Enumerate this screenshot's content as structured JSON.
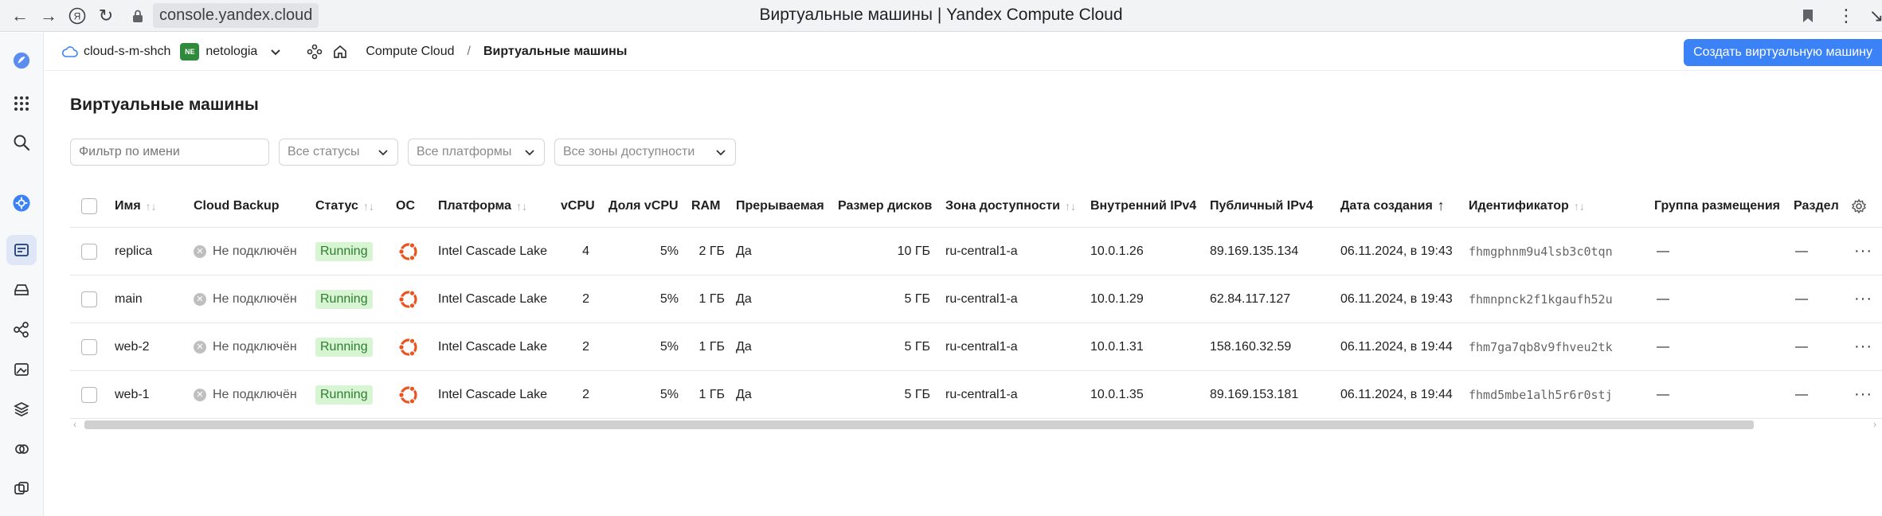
{
  "browser": {
    "url": "console.yandex.cloud",
    "tab_title": "Виртуальные машины | Yandex Compute Cloud"
  },
  "header": {
    "cloud": "cloud-s-m-shch",
    "folder_badge": "NE",
    "folder": "netologia",
    "breadcrumb_service": "Compute Cloud",
    "breadcrumb_sep": "/",
    "breadcrumb_current": "Виртуальные машины",
    "create_button": "Создать виртуальную машину"
  },
  "page": {
    "title": "Виртуальные машины"
  },
  "filters": {
    "name_placeholder": "Фильтр по имени",
    "status": "Все статусы",
    "platform": "Все платформы",
    "zone": "Все зоны доступности"
  },
  "table": {
    "columns": {
      "name": "Имя",
      "backup": "Cloud Backup",
      "status": "Статус",
      "os": "ОС",
      "platform": "Платформа",
      "vcpu": "vCPU",
      "core_fraction": "Доля vCPU",
      "ram": "RAM",
      "preemptible": "Прерываемая",
      "disk": "Размер дисков",
      "zone": "Зона доступности",
      "internal_ip": "Внутренний IPv4",
      "public_ip": "Публичный IPv4",
      "created": "Дата создания",
      "id": "Идентификатор",
      "placement": "Группа размещения",
      "section": "Раздел"
    },
    "rows": [
      {
        "name": "replica",
        "backup": "Не подключён",
        "status": "Running",
        "os": "ubuntu-icon",
        "platform": "Intel Cascade Lake",
        "vcpu": "4",
        "core_fraction": "5%",
        "ram": "2 ГБ",
        "preemptible": "Да",
        "disk": "10 ГБ",
        "zone": "ru-central1-a",
        "internal_ip": "10.0.1.26",
        "public_ip": "89.169.135.134",
        "created": "06.11.2024, в 19:43",
        "id": "fhmgphnm9u4lsb3c0tqn",
        "placement": "—",
        "section": "—"
      },
      {
        "name": "main",
        "backup": "Не подключён",
        "status": "Running",
        "os": "ubuntu-icon",
        "platform": "Intel Cascade Lake",
        "vcpu": "2",
        "core_fraction": "5%",
        "ram": "1 ГБ",
        "preemptible": "Да",
        "disk": "5 ГБ",
        "zone": "ru-central1-a",
        "internal_ip": "10.0.1.29",
        "public_ip": "62.84.117.127",
        "created": "06.11.2024, в 19:43",
        "id": "fhmnpnck2f1kgaufh52u",
        "placement": "—",
        "section": "—"
      },
      {
        "name": "web-2",
        "backup": "Не подключён",
        "status": "Running",
        "os": "ubuntu-icon",
        "platform": "Intel Cascade Lake",
        "vcpu": "2",
        "core_fraction": "5%",
        "ram": "1 ГБ",
        "preemptible": "Да",
        "disk": "5 ГБ",
        "zone": "ru-central1-a",
        "internal_ip": "10.0.1.31",
        "public_ip": "158.160.32.59",
        "created": "06.11.2024, в 19:44",
        "id": "fhm7ga7qb8v9fhveu2tk",
        "placement": "—",
        "section": "—"
      },
      {
        "name": "web-1",
        "backup": "Не подключён",
        "status": "Running",
        "os": "ubuntu-icon",
        "platform": "Intel Cascade Lake",
        "vcpu": "2",
        "core_fraction": "5%",
        "ram": "1 ГБ",
        "preemptible": "Да",
        "disk": "5 ГБ",
        "zone": "ru-central1-a",
        "internal_ip": "10.0.1.35",
        "public_ip": "89.169.153.181",
        "created": "06.11.2024, в 19:44",
        "id": "fhmd5mbe1alh5r6r0stj",
        "placement": "—",
        "section": "—"
      }
    ]
  },
  "colors": {
    "accent": "#3b82f6",
    "status_running_bg": "#d7f5d2",
    "status_running_fg": "#2e7d32",
    "ubuntu": "#e95420"
  }
}
